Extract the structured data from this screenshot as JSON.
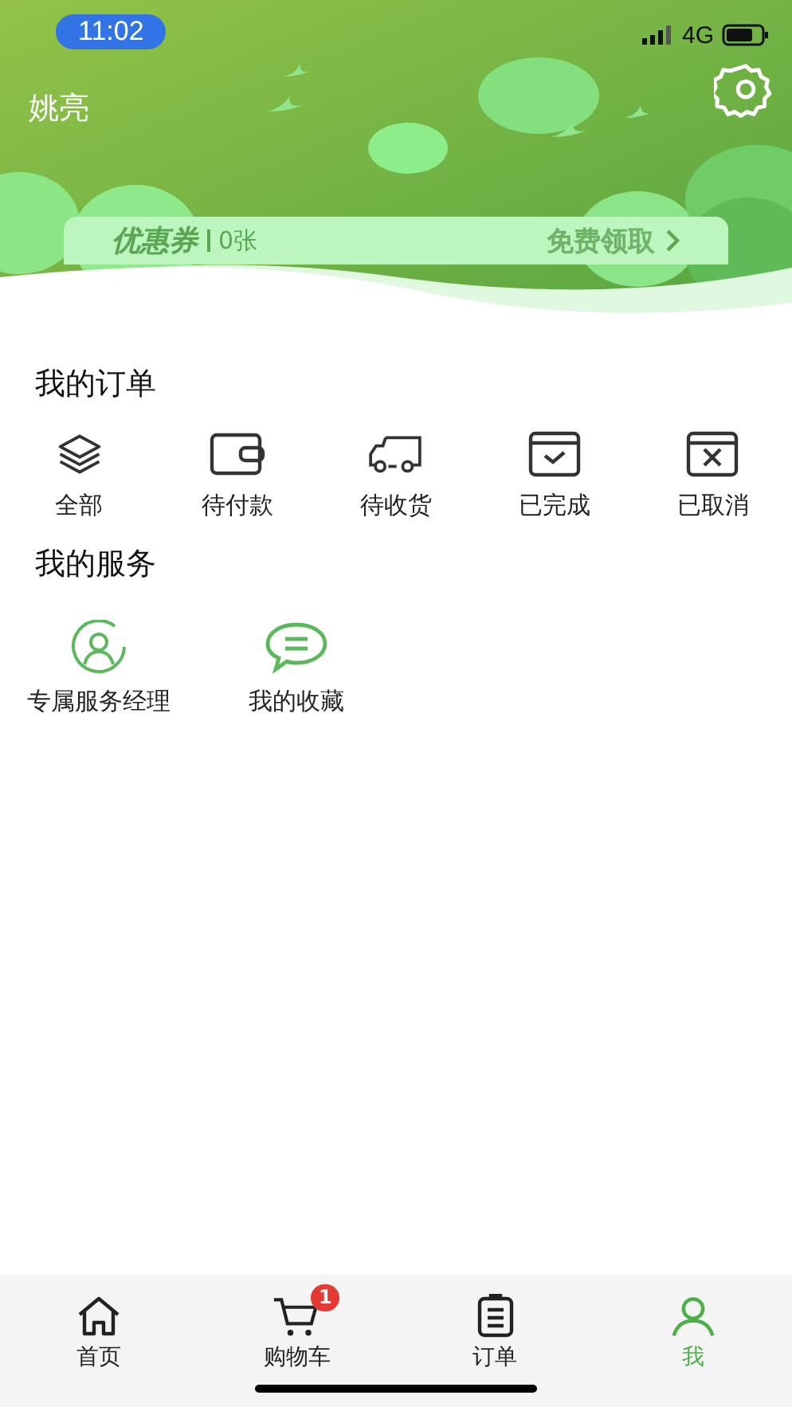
{
  "status_bar": {
    "time": "11:02",
    "network": "4G"
  },
  "profile": {
    "name": "姚亮"
  },
  "coupon": {
    "title": "优惠券",
    "count": "0张",
    "action": "免费领取"
  },
  "orders": {
    "title": "我的订单",
    "items": [
      {
        "kind": "layers",
        "label": "全部"
      },
      {
        "kind": "wallet",
        "label": "待付款"
      },
      {
        "kind": "truck",
        "label": "待收货"
      },
      {
        "kind": "done",
        "label": "已完成"
      },
      {
        "kind": "cancel",
        "label": "已取消"
      }
    ]
  },
  "services": {
    "title": "我的服务",
    "items": [
      {
        "kind": "manager",
        "label": "专属服务经理"
      },
      {
        "kind": "chat",
        "label": "我的收藏"
      }
    ]
  },
  "tab_bar": [
    {
      "kind": "home",
      "label": "首页",
      "selected": false
    },
    {
      "kind": "cart",
      "label": "购物车",
      "selected": false,
      "badge": "1"
    },
    {
      "kind": "orders",
      "label": "订单",
      "selected": false
    },
    {
      "kind": "me",
      "label": "我",
      "selected": true
    }
  ]
}
